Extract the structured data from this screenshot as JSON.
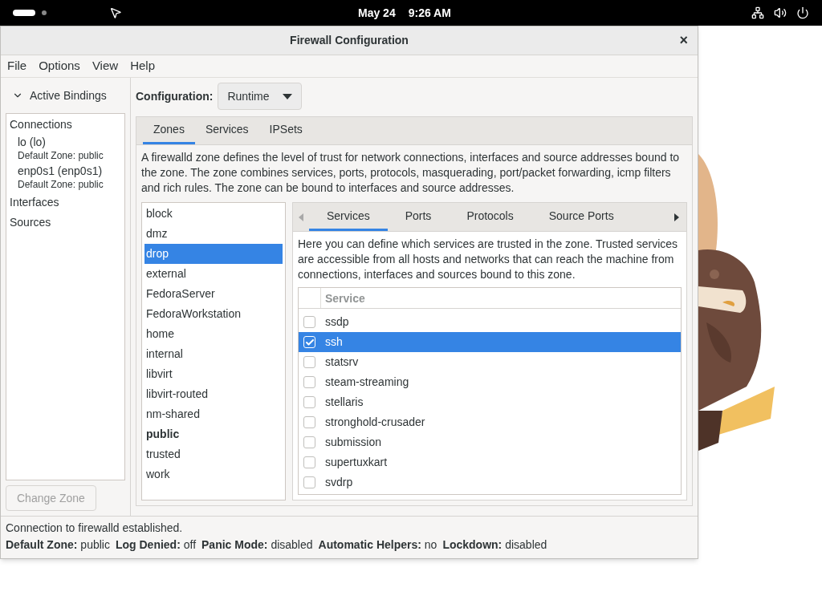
{
  "top_bar": {
    "date": "May 24",
    "time": "9:26 AM"
  },
  "window": {
    "title": "Firewall Configuration",
    "close": "×"
  },
  "menu": [
    "File",
    "Options",
    "View",
    "Help"
  ],
  "sidebar": {
    "header": "Active Bindings",
    "expanded": true,
    "items": [
      {
        "label": "Connections",
        "children": [
          {
            "label": "lo (lo)",
            "detail": "Default Zone: public"
          },
          {
            "label": "enp0s1 (enp0s1)",
            "detail": "Default Zone: public"
          }
        ]
      },
      {
        "label": "Interfaces"
      },
      {
        "label": "Sources"
      }
    ],
    "button": {
      "label": "Change Zone",
      "disabled": true
    }
  },
  "configuration": {
    "label": "Configuration:",
    "value": "Runtime"
  },
  "tabs": [
    {
      "label": "Zones",
      "selected": true
    },
    {
      "label": "Services",
      "selected": false
    },
    {
      "label": "IPSets",
      "selected": false
    }
  ],
  "zone_description": "A firewalld zone defines the level of trust for network connections, interfaces and source addresses bound to the zone. The zone combines services, ports, protocols, masquerading, port/packet forwarding, icmp filters and rich rules. The zone can be bound to interfaces and source addresses.",
  "zones": [
    {
      "label": "block",
      "selected": false,
      "is_default": false
    },
    {
      "label": "dmz",
      "selected": false,
      "is_default": false
    },
    {
      "label": "drop",
      "selected": true,
      "is_default": false
    },
    {
      "label": "external",
      "selected": false,
      "is_default": false
    },
    {
      "label": "FedoraServer",
      "selected": false,
      "is_default": false
    },
    {
      "label": "FedoraWorkstation",
      "selected": false,
      "is_default": false
    },
    {
      "label": "home",
      "selected": false,
      "is_default": false
    },
    {
      "label": "internal",
      "selected": false,
      "is_default": false
    },
    {
      "label": "libvirt",
      "selected": false,
      "is_default": false
    },
    {
      "label": "libvirt-routed",
      "selected": false,
      "is_default": false
    },
    {
      "label": "nm-shared",
      "selected": false,
      "is_default": false
    },
    {
      "label": "public",
      "selected": false,
      "is_default": true
    },
    {
      "label": "trusted",
      "selected": false,
      "is_default": false
    },
    {
      "label": "work",
      "selected": false,
      "is_default": false
    }
  ],
  "zone_tabs": [
    {
      "label": "Services",
      "selected": true
    },
    {
      "label": "Ports",
      "selected": false
    },
    {
      "label": "Protocols",
      "selected": false
    },
    {
      "label": "Source Ports",
      "selected": false
    }
  ],
  "services_description": "Here you can define which services are trusted in the zone. Trusted services are accessible from all hosts and networks that can reach the machine from connections, interfaces and sources bound to this zone.",
  "service_column": "Service",
  "services": [
    {
      "name": "ssdp",
      "checked": false,
      "selected": false
    },
    {
      "name": "ssh",
      "checked": true,
      "selected": true
    },
    {
      "name": "statsrv",
      "checked": false,
      "selected": false
    },
    {
      "name": "steam-streaming",
      "checked": false,
      "selected": false
    },
    {
      "name": "stellaris",
      "checked": false,
      "selected": false
    },
    {
      "name": "stronghold-crusader",
      "checked": false,
      "selected": false
    },
    {
      "name": "submission",
      "checked": false,
      "selected": false
    },
    {
      "name": "supertuxkart",
      "checked": false,
      "selected": false
    },
    {
      "name": "svdrp",
      "checked": false,
      "selected": false
    }
  ],
  "status": {
    "message": "Connection to firewalld established.",
    "fields": [
      {
        "label": "Default Zone:",
        "value": "public"
      },
      {
        "label": "Log Denied:",
        "value": "off"
      },
      {
        "label": "Panic Mode:",
        "value": "disabled"
      },
      {
        "label": "Automatic Helpers:",
        "value": "no"
      },
      {
        "label": "Lockdown:",
        "value": "disabled"
      }
    ]
  }
}
